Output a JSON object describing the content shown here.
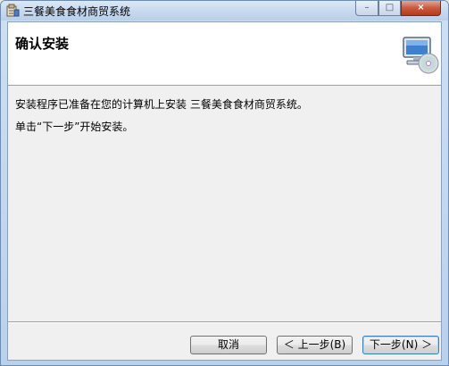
{
  "window": {
    "title": "三餐美食食材商贸系统",
    "controls": {
      "minimize": "–",
      "maximize": "□",
      "close": "×"
    }
  },
  "banner": {
    "title": "确认安装",
    "icon": "computer-cd-icon"
  },
  "content": {
    "line1": "安装程序已准备在您的计算机上安装 三餐美食食材商贸系统。",
    "line2": "单击“下一步”开始安装。"
  },
  "buttons": {
    "cancel": "取消",
    "back": "＜ 上一步(B)",
    "next": "下一步(N) ＞"
  }
}
